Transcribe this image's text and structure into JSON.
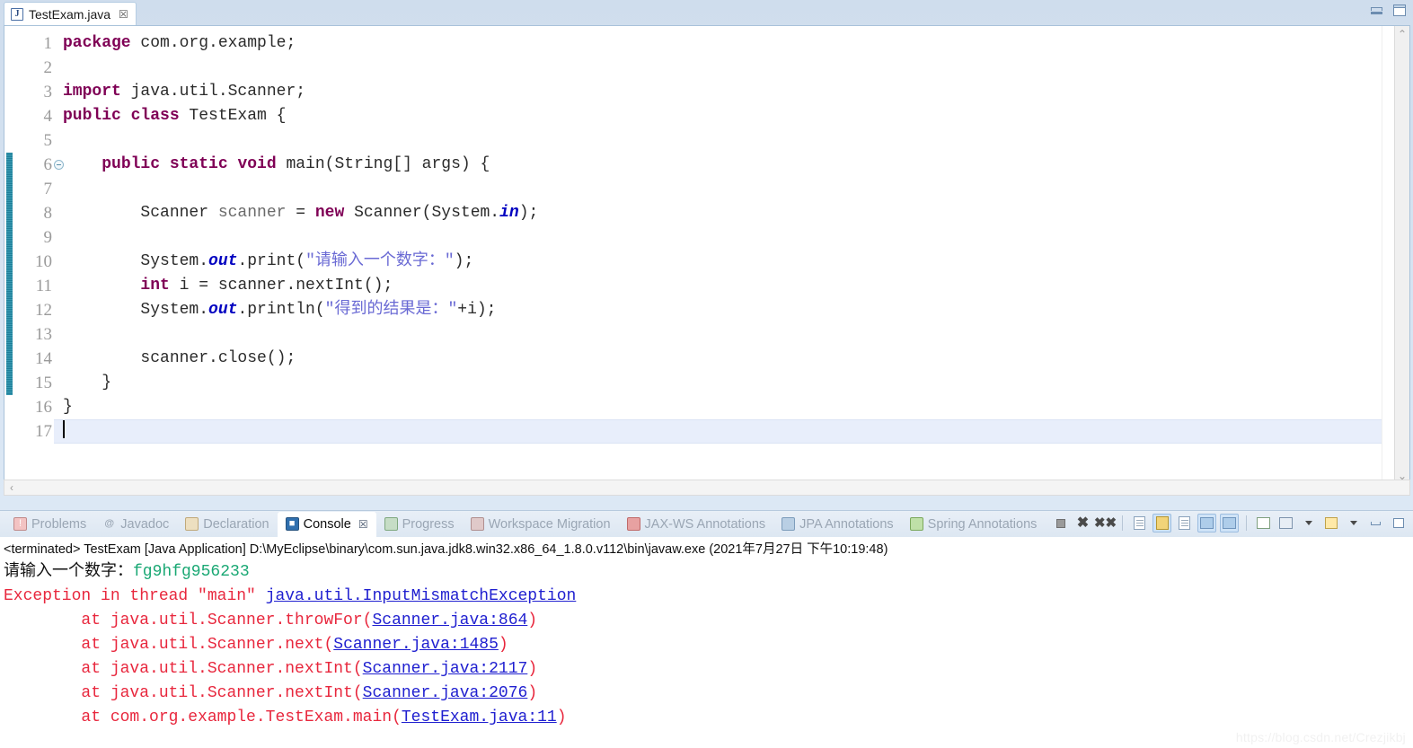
{
  "window": {
    "minimize_label": "minimize",
    "maximize_label": "maximize"
  },
  "editor": {
    "tab": {
      "icon": "java-file-icon",
      "title": "TestExam.java",
      "close": "☒"
    },
    "line_numbers": [
      "1",
      "2",
      "3",
      "4",
      "5",
      "6",
      "7",
      "8",
      "9",
      "10",
      "11",
      "12",
      "13",
      "14",
      "15",
      "16",
      "17"
    ],
    "current_line": 17,
    "fold_marker_line": 6,
    "change_bar_from_line": 6,
    "change_bar_to_line": 15,
    "code": [
      {
        "n": 1,
        "tokens": [
          {
            "t": "package",
            "c": "kw"
          },
          {
            "t": " com.org.example;",
            "c": "plain"
          }
        ]
      },
      {
        "n": 2,
        "tokens": []
      },
      {
        "n": 3,
        "tokens": [
          {
            "t": "import",
            "c": "kw"
          },
          {
            "t": " java.util.Scanner;",
            "c": "plain"
          }
        ]
      },
      {
        "n": 4,
        "tokens": [
          {
            "t": "public class",
            "c": "kw"
          },
          {
            "t": " TestExam {",
            "c": "plain"
          }
        ]
      },
      {
        "n": 5,
        "tokens": []
      },
      {
        "n": 6,
        "tokens": [
          {
            "t": "    ",
            "c": "plain"
          },
          {
            "t": "public static void",
            "c": "kw"
          },
          {
            "t": " main(String[] args) {",
            "c": "plain"
          }
        ]
      },
      {
        "n": 7,
        "tokens": []
      },
      {
        "n": 8,
        "tokens": [
          {
            "t": "        Scanner ",
            "c": "plain"
          },
          {
            "t": "scanner",
            "c": "local"
          },
          {
            "t": " = ",
            "c": "plain"
          },
          {
            "t": "new",
            "c": "kw"
          },
          {
            "t": " Scanner(System.",
            "c": "plain"
          },
          {
            "t": "in",
            "c": "fld"
          },
          {
            "t": ");",
            "c": "plain"
          }
        ]
      },
      {
        "n": 9,
        "tokens": []
      },
      {
        "n": 10,
        "tokens": [
          {
            "t": "        System.",
            "c": "plain"
          },
          {
            "t": "out",
            "c": "fld"
          },
          {
            "t": ".print(",
            "c": "plain"
          },
          {
            "t": "\"请输入一个数字：\"",
            "c": "str"
          },
          {
            "t": ");",
            "c": "plain"
          }
        ]
      },
      {
        "n": 11,
        "tokens": [
          {
            "t": "        ",
            "c": "plain"
          },
          {
            "t": "int",
            "c": "kw"
          },
          {
            "t": " i = scanner.nextInt();",
            "c": "plain"
          }
        ]
      },
      {
        "n": 12,
        "tokens": [
          {
            "t": "        System.",
            "c": "plain"
          },
          {
            "t": "out",
            "c": "fld"
          },
          {
            "t": ".println(",
            "c": "plain"
          },
          {
            "t": "\"得到的结果是：\"",
            "c": "str"
          },
          {
            "t": "+i);",
            "c": "plain"
          }
        ]
      },
      {
        "n": 13,
        "tokens": []
      },
      {
        "n": 14,
        "tokens": [
          {
            "t": "        scanner.close();",
            "c": "plain"
          }
        ]
      },
      {
        "n": 15,
        "tokens": [
          {
            "t": "    }",
            "c": "plain"
          }
        ]
      },
      {
        "n": 16,
        "tokens": [
          {
            "t": "}",
            "c": "plain"
          }
        ]
      },
      {
        "n": 17,
        "tokens": []
      }
    ],
    "scroll": {
      "up_arrow": "⌃",
      "down_arrow": "⌄",
      "left_arrow": "‹",
      "right_arrow": "›"
    }
  },
  "console_panel": {
    "tabs": [
      {
        "label": "Problems",
        "icon": "problems-icon",
        "active": false,
        "icon_class": "ic-problems",
        "glyph": "!"
      },
      {
        "label": "Javadoc",
        "icon": "javadoc-icon",
        "active": false,
        "icon_class": "ic-javadoc",
        "glyph": "@"
      },
      {
        "label": "Declaration",
        "icon": "declaration-icon",
        "active": false,
        "icon_class": "ic-decl",
        "glyph": ""
      },
      {
        "label": "Console",
        "icon": "console-icon",
        "active": true,
        "icon_class": "ic-console",
        "glyph": "■"
      },
      {
        "label": "Progress",
        "icon": "progress-icon",
        "active": false,
        "icon_class": "ic-progress",
        "glyph": ""
      },
      {
        "label": "Workspace Migration",
        "icon": "workspace-migration-icon",
        "active": false,
        "icon_class": "ic-workspace",
        "glyph": ""
      },
      {
        "label": "JAX-WS Annotations",
        "icon": "jaxws-annotations-icon",
        "active": false,
        "icon_class": "ic-jaxws",
        "glyph": ""
      },
      {
        "label": "JPA Annotations",
        "icon": "jpa-annotations-icon",
        "active": false,
        "icon_class": "ic-jpa",
        "glyph": ""
      },
      {
        "label": "Spring Annotations",
        "icon": "spring-annotations-icon",
        "active": false,
        "icon_class": "ic-spring",
        "glyph": ""
      }
    ],
    "active_tab_close": "☒",
    "toolbar": [
      {
        "name": "terminate-button",
        "kind": "stop"
      },
      {
        "name": "remove-launch-button",
        "kind": "x"
      },
      {
        "name": "remove-all-terminated-button",
        "kind": "xx"
      },
      {
        "name": "separator",
        "kind": "sep"
      },
      {
        "name": "clear-console-button",
        "kind": "doc"
      },
      {
        "name": "scroll-lock-button",
        "kind": "lock",
        "toggled": true
      },
      {
        "name": "word-wrap-button",
        "kind": "doc2"
      },
      {
        "name": "show-console-on-output-button",
        "kind": "blue",
        "toggled": true
      },
      {
        "name": "show-console-on-error-button",
        "kind": "blue2",
        "toggled": true
      },
      {
        "name": "separator2",
        "kind": "sep"
      },
      {
        "name": "pin-console-button",
        "kind": "green"
      },
      {
        "name": "display-selected-console-button",
        "kind": "mon"
      },
      {
        "name": "display-selected-console-menu",
        "kind": "caret"
      },
      {
        "name": "open-console-button",
        "kind": "newf"
      },
      {
        "name": "open-console-menu",
        "kind": "caret"
      },
      {
        "name": "minimize-button",
        "kind": "min"
      },
      {
        "name": "maximize-button",
        "kind": "max"
      }
    ],
    "terminated_line": "<terminated> TestExam [Java Application] D:\\MyEclipse\\binary\\com.sun.java.jdk8.win32.x86_64_1.8.0.v112\\bin\\javaw.exe (2021年7月27日 下午10:19:48)",
    "output": [
      {
        "type": "prompt",
        "segments": [
          {
            "t": "请输入一个数字：",
            "c": "o-black"
          },
          {
            "t": "fg9hfg956233",
            "c": "o-green"
          }
        ]
      },
      {
        "type": "error",
        "segments": [
          {
            "t": "Exception in thread \"main\" ",
            "c": "o-red"
          },
          {
            "t": "java.util.InputMismatchException",
            "c": "o-link"
          }
        ]
      },
      {
        "type": "error",
        "segments": [
          {
            "t": "        at java.util.Scanner.throwFor(",
            "c": "o-red"
          },
          {
            "t": "Scanner.java:864",
            "c": "o-link"
          },
          {
            "t": ")",
            "c": "o-red"
          }
        ]
      },
      {
        "type": "error",
        "segments": [
          {
            "t": "        at java.util.Scanner.next(",
            "c": "o-red"
          },
          {
            "t": "Scanner.java:1485",
            "c": "o-link"
          },
          {
            "t": ")",
            "c": "o-red"
          }
        ]
      },
      {
        "type": "error",
        "segments": [
          {
            "t": "        at java.util.Scanner.nextInt(",
            "c": "o-red"
          },
          {
            "t": "Scanner.java:2117",
            "c": "o-link"
          },
          {
            "t": ")",
            "c": "o-red"
          }
        ]
      },
      {
        "type": "error",
        "segments": [
          {
            "t": "        at java.util.Scanner.nextInt(",
            "c": "o-red"
          },
          {
            "t": "Scanner.java:2076",
            "c": "o-link"
          },
          {
            "t": ")",
            "c": "o-red"
          }
        ]
      },
      {
        "type": "error",
        "segments": [
          {
            "t": "        at com.org.example.TestExam.main(",
            "c": "o-red"
          },
          {
            "t": "TestExam.java:11",
            "c": "o-link"
          },
          {
            "t": ")",
            "c": "o-red"
          }
        ]
      }
    ]
  },
  "watermark": "https://blog.csdn.net/Crezjikbj"
}
